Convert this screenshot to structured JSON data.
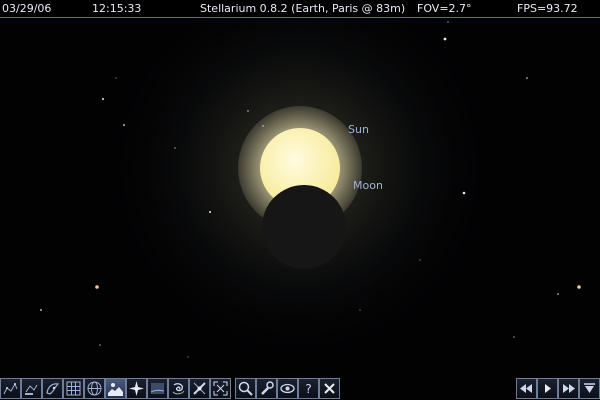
{
  "status_bar": {
    "date": "03/29/06",
    "time": "12:15:33",
    "title": "Stellarium 0.8.2 (Earth, Paris @ 83m)",
    "fov": "FOV=2.7°",
    "fps": "FPS=93.72"
  },
  "sky": {
    "sun_label": "Sun",
    "moon_label": "Moon",
    "sun_color": "#fbf0b0",
    "moon_color": "#161616",
    "label_color": "#9fb2d8"
  },
  "toolbar": {
    "buttons": [
      {
        "icon": "constellation-lines-icon",
        "active": false
      },
      {
        "icon": "constellation-names-icon",
        "active": false
      },
      {
        "icon": "constellation-art-icon",
        "active": false
      },
      {
        "icon": "azimuthal-grid-icon",
        "active": false
      },
      {
        "icon": "equatorial-grid-icon",
        "active": false
      },
      {
        "icon": "ground-icon",
        "active": true
      },
      {
        "icon": "cardinal-points-icon",
        "active": false
      },
      {
        "icon": "atmosphere-icon",
        "active": false
      },
      {
        "icon": "nebulas-icon",
        "active": false
      },
      {
        "icon": "telescope-mount-icon",
        "active": false
      },
      {
        "icon": "center-on-selection-icon",
        "active": false
      },
      {
        "icon": "search-icon",
        "active": false
      },
      {
        "icon": "configuration-icon",
        "active": false
      },
      {
        "icon": "night-mode-icon",
        "active": false
      },
      {
        "icon": "help-icon",
        "active": false
      },
      {
        "icon": "quit-icon",
        "active": false
      }
    ],
    "help_label": "?"
  },
  "time_controls": {
    "buttons": [
      {
        "icon": "rewind-icon"
      },
      {
        "icon": "play-icon"
      },
      {
        "icon": "fast-forward-icon"
      },
      {
        "icon": "now-icon"
      }
    ]
  }
}
